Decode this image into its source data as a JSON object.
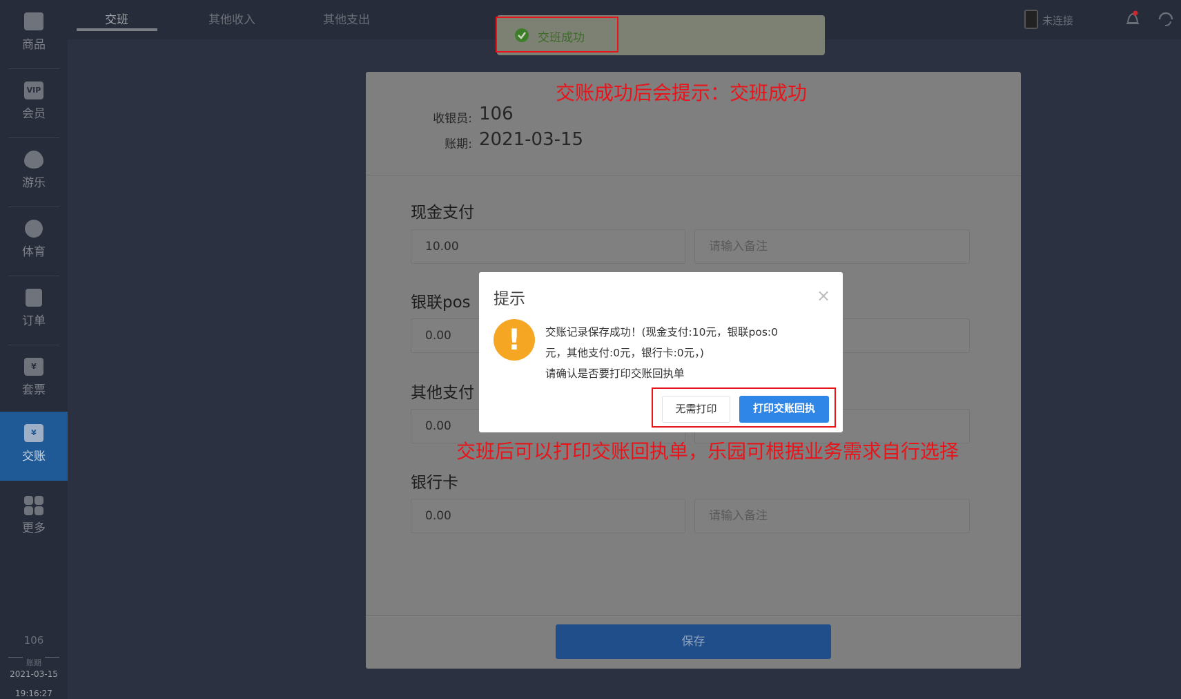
{
  "sidebar": {
    "items": [
      {
        "label": "商品",
        "icon": "shopping-bag-icon"
      },
      {
        "label": "会员",
        "icon": "vip-card-icon",
        "glyph": "VIP"
      },
      {
        "label": "游乐",
        "icon": "balloon-icon"
      },
      {
        "label": "体育",
        "icon": "ball-icon"
      },
      {
        "label": "订单",
        "icon": "clipboard-icon"
      },
      {
        "label": "套票",
        "icon": "ticket-icon",
        "glyph": "¥"
      },
      {
        "label": "交账",
        "icon": "handover-icon",
        "glyph": "¥",
        "active": true
      },
      {
        "label": "更多",
        "icon": "grid-icon"
      }
    ],
    "footer": {
      "cashier": "106",
      "period_label": "账期",
      "date": "2021-03-15",
      "time": "19:16:27"
    }
  },
  "tabs": [
    {
      "label": "交班",
      "active": true
    },
    {
      "label": "其他收入"
    },
    {
      "label": "其他支出"
    }
  ],
  "topright": {
    "device_status": "未连接"
  },
  "toast": {
    "text": "交班成功",
    "type": "success"
  },
  "card": {
    "cashier_label": "收银员:",
    "cashier": "106",
    "period_label": "账期:",
    "period": "2021-03-15",
    "sections": [
      {
        "label": "现金支付",
        "amount": "10.00",
        "remark_placeholder": "请输入备注"
      },
      {
        "label": "银联pos",
        "amount": "0.00",
        "remark_placeholder": "请输入备注"
      },
      {
        "label": "其他支付",
        "amount": "0.00",
        "remark_placeholder": "请输入备注"
      },
      {
        "label": "银行卡",
        "amount": "0.00",
        "remark_placeholder": "请输入备注"
      }
    ],
    "save_label": "保存"
  },
  "dialog": {
    "title": "提示",
    "line1": "交账记录保存成功！(现金支付:10元，银联pos:0",
    "line2": "元，其他支付:0元，银行卡:0元，)",
    "line3": "请确认是否要打印交账回执单",
    "cancel_label": "无需打印",
    "confirm_label": "打印交账回执"
  },
  "annotations": {
    "top": "交账成功后会提示：交班成功",
    "bottom": "交班后可以打印交账回执单，乐园可根据业务需求自行选择"
  },
  "colors": {
    "accent": "#2f86e6",
    "warning": "#f5a623",
    "success": "#3e7d2a",
    "annotation": "#e8141a"
  }
}
